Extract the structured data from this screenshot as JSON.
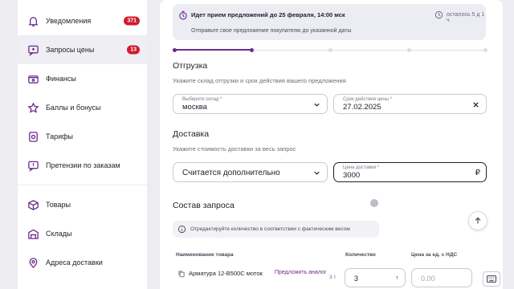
{
  "sidebar": {
    "items": [
      {
        "label": "Уведомления",
        "icon": "bell-icon",
        "badge": "371"
      },
      {
        "label": "Запросы цены",
        "icon": "chat-icon",
        "badge": "13",
        "active": true
      },
      {
        "label": "Финансы",
        "icon": "wallet-icon"
      },
      {
        "label": "Баллы и бонусы",
        "icon": "star-icon"
      },
      {
        "label": "Тарифы",
        "icon": "tariff-icon"
      },
      {
        "label": "Претензии по заказам",
        "icon": "claim-icon"
      },
      {
        "label": "Товары",
        "icon": "box-icon"
      },
      {
        "label": "Склады",
        "icon": "warehouse-icon"
      },
      {
        "label": "Адреса доставки",
        "icon": "pin-icon"
      }
    ]
  },
  "deadline": {
    "title": "Идет прием предложений до 25 февраля, 14:00 мск",
    "subtitle": "Отправьте свое предложение покупателю до указанной даты",
    "remaining": "осталось 5 д 1 ч"
  },
  "progress": {
    "step": 2,
    "total": 5
  },
  "shipment": {
    "heading": "Отгрузка",
    "hint": "Укажите склад отгрузки и срок действия вашего предложения",
    "warehouse": {
      "label": "Выберите склад *",
      "value": "москва"
    },
    "validity": {
      "label": "Срок действия цены *",
      "value": "27.02.2025"
    }
  },
  "delivery": {
    "heading": "Доставка",
    "hint": "Укажите стоимость доставки за весь запрос",
    "mode": {
      "value": "Считается дополнительно"
    },
    "price": {
      "label": "Цена доставки *",
      "value": "3000",
      "currency": "₽"
    }
  },
  "request": {
    "heading": "Состав запроса",
    "info": "Отредактируйте количество в соответствии с фактическим весом",
    "columns": [
      "Наименование товара",
      "Количество",
      "Цена за ед. с НДС"
    ],
    "row": {
      "name": "Арматура 12-В500С моток",
      "link": "Предложить аналог",
      "unit": "3 т",
      "qty": "3",
      "qty_unit": "т",
      "price_placeholder": "0.00"
    }
  },
  "colors": {
    "accent": "#6b2d8e",
    "badge": "#d01b2c"
  }
}
